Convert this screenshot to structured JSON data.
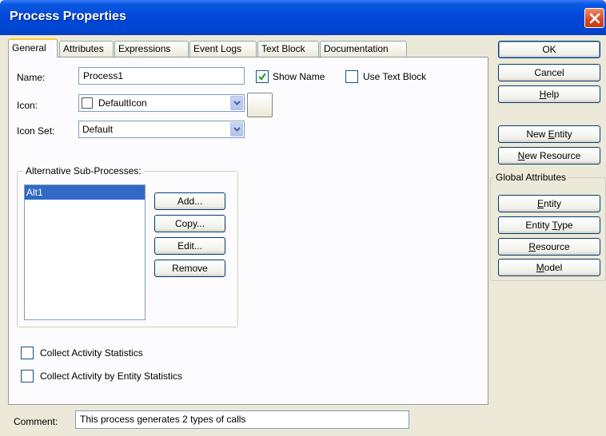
{
  "window": {
    "title": "Process Properties"
  },
  "tabs": [
    {
      "label": "General"
    },
    {
      "label": "Attributes"
    },
    {
      "label": "Expressions"
    },
    {
      "label": "Event Logs"
    },
    {
      "label": "Text Block"
    },
    {
      "label": "Documentation"
    }
  ],
  "general": {
    "name_label": "Name:",
    "name_value": "Process1",
    "show_name_label": "Show Name",
    "show_name_checked": true,
    "use_text_block_label": "Use Text Block",
    "use_text_block_checked": false,
    "icon_label": "Icon:",
    "icon_value": "DefaultIcon",
    "icon_set_label": "Icon Set:",
    "icon_set_value": "Default",
    "alt_group_label": "Alternative Sub-Processes:",
    "alt_items": [
      "Alt1"
    ],
    "selected_alt_index": 0,
    "add_label": "Add...",
    "copy_label": "Copy...",
    "edit_label": "Edit...",
    "remove_label": "Remove",
    "collect_activity_label": "Collect Activity Statistics",
    "collect_activity_checked": false,
    "collect_entity_label": "Collect Activity by Entity Statistics",
    "collect_entity_checked": false
  },
  "comment": {
    "label": "Comment:",
    "value": "This process generates 2 types of calls"
  },
  "actions": {
    "ok": "OK",
    "cancel": "Cancel",
    "help_pre": "",
    "help_u": "H",
    "help_post": "elp",
    "new_entity_pre": "New ",
    "new_entity_u": "E",
    "new_entity_post": "ntity",
    "new_resource_pre": "",
    "new_resource_u": "N",
    "new_resource_post": "ew Resource"
  },
  "global_attributes": {
    "label": "Global Attributes",
    "entity_pre": "",
    "entity_u": "E",
    "entity_post": "ntity",
    "entity_type_pre": "Entity ",
    "entity_type_u": "T",
    "entity_type_post": "ype",
    "resource_pre": "",
    "resource_u": "R",
    "resource_post": "esource",
    "model_pre": "",
    "model_u": "M",
    "model_post": "odel"
  },
  "colors": {
    "titlebar": "#0047d8",
    "selection": "#316ac5",
    "check": "#21a121"
  }
}
